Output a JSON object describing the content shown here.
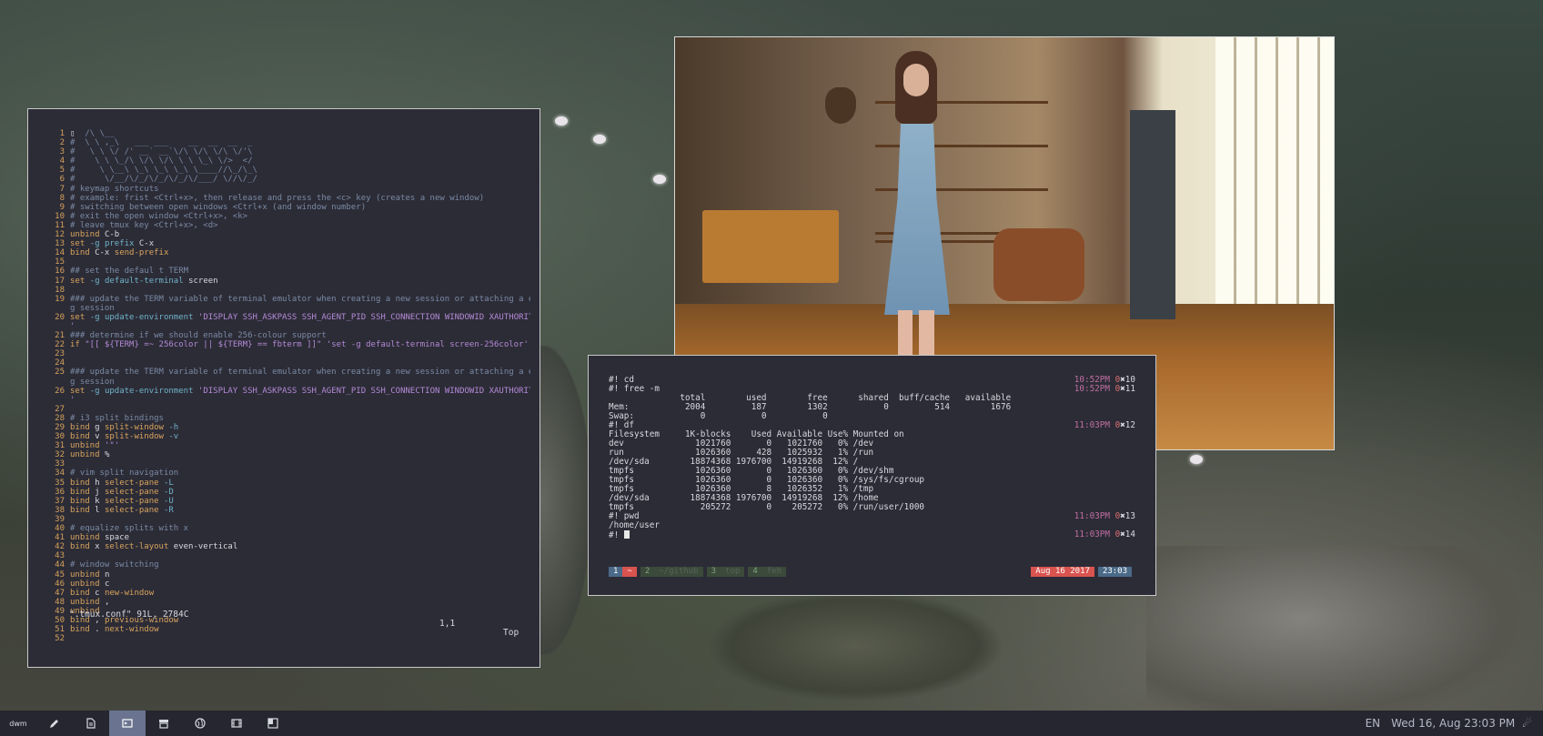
{
  "vim": {
    "lines": [
      {
        "n": "1",
        "segs": [
          [
            "c-plain",
            "▯"
          ],
          [
            "c-cmt",
            "  /\\ \\__"
          ]
        ]
      },
      {
        "n": "2",
        "segs": [
          [
            "c-cmt",
            "#  \\ \\ ,_\\   ___ ___    __  __  __  _"
          ]
        ]
      },
      {
        "n": "3",
        "segs": [
          [
            "c-cmt",
            "#   \\ \\ \\/ /' __` __`\\/\\ \\/\\ \\/\\ \\/'\\"
          ]
        ]
      },
      {
        "n": "4",
        "segs": [
          [
            "c-cmt",
            "#    \\ \\ \\_/\\ \\/\\ \\/\\ \\ \\ \\_\\ \\/>  </"
          ]
        ]
      },
      {
        "n": "5",
        "segs": [
          [
            "c-cmt",
            "#     \\ \\__\\ \\_\\ \\_\\ \\_\\ \\____//\\_/\\_\\"
          ]
        ]
      },
      {
        "n": "6",
        "segs": [
          [
            "c-cmt",
            "#      \\/__/\\/_/\\/_/\\/_/\\/___/ \\//\\/_/"
          ]
        ]
      },
      {
        "n": "7",
        "segs": [
          [
            "c-cmt",
            "# keymap shortcuts"
          ]
        ]
      },
      {
        "n": "8",
        "segs": [
          [
            "c-cmt",
            "# example: frist <Ctrl+x>, then release and press the <c> key (creates a new window)"
          ]
        ]
      },
      {
        "n": "9",
        "segs": [
          [
            "c-cmt",
            "# switching between open windows <Ctrl+x (and window number)"
          ]
        ]
      },
      {
        "n": "10",
        "segs": [
          [
            "c-cmt",
            "# exit the open window <Ctrl+x>, <k>"
          ]
        ]
      },
      {
        "n": "11",
        "segs": [
          [
            "c-cmt",
            "# leave tmux key <Ctrl+x>, <d>"
          ]
        ]
      },
      {
        "n": "12",
        "segs": [
          [
            "c-kw",
            "unbind "
          ],
          [
            "c-plain",
            "C-b"
          ]
        ]
      },
      {
        "n": "13",
        "segs": [
          [
            "c-kw",
            "set "
          ],
          [
            "c-opt",
            "-g prefix "
          ],
          [
            "c-plain",
            "C-x"
          ]
        ]
      },
      {
        "n": "14",
        "segs": [
          [
            "c-kw",
            "bind "
          ],
          [
            "c-plain",
            "C-x "
          ],
          [
            "c-kw",
            "send-prefix"
          ]
        ]
      },
      {
        "n": "15",
        "segs": []
      },
      {
        "n": "16",
        "segs": [
          [
            "c-cmt",
            "## set the defaul t TERM"
          ]
        ]
      },
      {
        "n": "17",
        "segs": [
          [
            "c-kw",
            "set "
          ],
          [
            "c-opt",
            "-g default-terminal "
          ],
          [
            "c-plain",
            "screen"
          ]
        ]
      },
      {
        "n": "18",
        "segs": []
      },
      {
        "n": "19",
        "segs": [
          [
            "c-cmt",
            "### update the TERM variable of terminal emulator when creating a new session or attaching a existin"
          ]
        ]
      },
      {
        "n": "",
        "segs": [
          [
            "c-cmt",
            "g session"
          ]
        ]
      },
      {
        "n": "20",
        "segs": [
          [
            "c-kw",
            "set "
          ],
          [
            "c-opt",
            "-g update-environment "
          ],
          [
            "c-str",
            "'DISPLAY SSH_ASKPASS SSH_AGENT_PID SSH_CONNECTION WINDOWID XAUTHORITY TERM"
          ]
        ]
      },
      {
        "n": "",
        "segs": [
          [
            "c-str",
            "'"
          ]
        ]
      },
      {
        "n": "21",
        "segs": [
          [
            "c-cmt",
            "### determine if we should enable 256-colour support"
          ]
        ]
      },
      {
        "n": "22",
        "segs": [
          [
            "c-kw",
            "if "
          ],
          [
            "c-str",
            "\"[[ ${TERM} =~ 256color || ${TERM} == fbterm ]]\" 'set -g default-terminal screen-256color'"
          ]
        ]
      },
      {
        "n": "23",
        "segs": []
      },
      {
        "n": "24",
        "segs": []
      },
      {
        "n": "25",
        "segs": [
          [
            "c-cmt",
            "### update the TERM variable of terminal emulator when creating a new session or attaching a existin"
          ]
        ]
      },
      {
        "n": "",
        "segs": [
          [
            "c-cmt",
            "g session"
          ]
        ]
      },
      {
        "n": "26",
        "segs": [
          [
            "c-kw",
            "set "
          ],
          [
            "c-opt",
            "-g update-environment "
          ],
          [
            "c-str",
            "'DISPLAY SSH_ASKPASS SSH_AGENT_PID SSH_CONNECTION WINDOWID XAUTHORITY TERM"
          ]
        ]
      },
      {
        "n": "",
        "segs": [
          [
            "c-str",
            "'"
          ]
        ]
      },
      {
        "n": "27",
        "segs": []
      },
      {
        "n": "28",
        "segs": [
          [
            "c-cmt",
            "# i3 split bindings"
          ]
        ]
      },
      {
        "n": "29",
        "segs": [
          [
            "c-kw",
            "bind "
          ],
          [
            "c-plain",
            "g "
          ],
          [
            "c-kw",
            "split-window "
          ],
          [
            "c-opt",
            "-h"
          ]
        ]
      },
      {
        "n": "30",
        "segs": [
          [
            "c-kw",
            "bind "
          ],
          [
            "c-plain",
            "v "
          ],
          [
            "c-kw",
            "split-window "
          ],
          [
            "c-opt",
            "-v"
          ]
        ]
      },
      {
        "n": "31",
        "segs": [
          [
            "c-kw",
            "unbind "
          ],
          [
            "c-str",
            "'\"'"
          ]
        ]
      },
      {
        "n": "32",
        "segs": [
          [
            "c-kw",
            "unbind "
          ],
          [
            "c-plain",
            "%"
          ]
        ]
      },
      {
        "n": "33",
        "segs": []
      },
      {
        "n": "34",
        "segs": [
          [
            "c-cmt",
            "# vim split navigation"
          ]
        ]
      },
      {
        "n": "35",
        "segs": [
          [
            "c-kw",
            "bind "
          ],
          [
            "c-plain",
            "h "
          ],
          [
            "c-kw",
            "select-pane "
          ],
          [
            "c-opt",
            "-L"
          ]
        ]
      },
      {
        "n": "36",
        "segs": [
          [
            "c-kw",
            "bind "
          ],
          [
            "c-plain",
            "j "
          ],
          [
            "c-kw",
            "select-pane "
          ],
          [
            "c-opt",
            "-D"
          ]
        ]
      },
      {
        "n": "37",
        "segs": [
          [
            "c-kw",
            "bind "
          ],
          [
            "c-plain",
            "k "
          ],
          [
            "c-kw",
            "select-pane "
          ],
          [
            "c-opt",
            "-U"
          ]
        ]
      },
      {
        "n": "38",
        "segs": [
          [
            "c-kw",
            "bind "
          ],
          [
            "c-plain",
            "l "
          ],
          [
            "c-kw",
            "select-pane "
          ],
          [
            "c-opt",
            "-R"
          ]
        ]
      },
      {
        "n": "39",
        "segs": []
      },
      {
        "n": "40",
        "segs": [
          [
            "c-cmt",
            "# equalize splits with x"
          ]
        ]
      },
      {
        "n": "41",
        "segs": [
          [
            "c-kw",
            "unbind "
          ],
          [
            "c-plain",
            "space"
          ]
        ]
      },
      {
        "n": "42",
        "segs": [
          [
            "c-kw",
            "bind "
          ],
          [
            "c-plain",
            "x "
          ],
          [
            "c-kw",
            "select-layout "
          ],
          [
            "c-plain",
            "even-vertical"
          ]
        ]
      },
      {
        "n": "43",
        "segs": []
      },
      {
        "n": "44",
        "segs": [
          [
            "c-cmt",
            "# window switching"
          ]
        ]
      },
      {
        "n": "45",
        "segs": [
          [
            "c-kw",
            "unbind "
          ],
          [
            "c-plain",
            "n"
          ]
        ]
      },
      {
        "n": "46",
        "segs": [
          [
            "c-kw",
            "unbind "
          ],
          [
            "c-plain",
            "c"
          ]
        ]
      },
      {
        "n": "47",
        "segs": [
          [
            "c-kw",
            "bind "
          ],
          [
            "c-plain",
            "c "
          ],
          [
            "c-kw",
            "new-window"
          ]
        ]
      },
      {
        "n": "48",
        "segs": [
          [
            "c-kw",
            "unbind "
          ],
          [
            "c-plain",
            ","
          ]
        ]
      },
      {
        "n": "49",
        "segs": [
          [
            "c-kw",
            "unbind "
          ],
          [
            "c-plain",
            "."
          ]
        ]
      },
      {
        "n": "50",
        "segs": [
          [
            "c-kw",
            "bind "
          ],
          [
            "c-plain",
            ", "
          ],
          [
            "c-kw",
            "previous-window"
          ]
        ]
      },
      {
        "n": "51",
        "segs": [
          [
            "c-kw",
            "bind "
          ],
          [
            "c-plain",
            ". "
          ],
          [
            "c-kw",
            "next-window"
          ]
        ]
      },
      {
        "n": "52",
        "segs": []
      }
    ],
    "status_file": "\".tmux.conf\" 91L, 2784C",
    "status_pos": "1,1",
    "status_scroll": "Top"
  },
  "terminal": {
    "rows": [
      {
        "text": "#! cd",
        "ts": "10:52PM ",
        "st": "0",
        "idx": "10"
      },
      {
        "text": "#! free -m",
        "ts": "10:52PM ",
        "st": "0",
        "idx": "11"
      },
      {
        "text": "              total        used        free      shared  buff/cache   available"
      },
      {
        "text": "Mem:           2004         187        1302           0         514        1676"
      },
      {
        "text": "Swap:             0           0           0"
      },
      {
        "text": "#! df",
        "ts": "11:03PM ",
        "st": "0",
        "idx": "12"
      },
      {
        "text": "Filesystem     1K-blocks    Used Available Use% Mounted on"
      },
      {
        "text": "dev              1021760       0   1021760   0% /dev"
      },
      {
        "text": "run              1026360     428   1025932   1% /run"
      },
      {
        "text": "/dev/sda        18874368 1976700  14919268  12% /"
      },
      {
        "text": "tmpfs            1026360       0   1026360   0% /dev/shm"
      },
      {
        "text": "tmpfs            1026360       0   1026360   0% /sys/fs/cgroup"
      },
      {
        "text": "tmpfs            1026360       8   1026352   1% /tmp"
      },
      {
        "text": "/dev/sda        18874368 1976700  14919268  12% /home"
      },
      {
        "text": "tmpfs             205272       0    205272   0% /run/user/1000"
      },
      {
        "text": "#! pwd",
        "ts": "11:03PM ",
        "st": "0",
        "idx": "13"
      },
      {
        "text": "/home/user"
      },
      {
        "text": "#! ",
        "ts": "11:03PM ",
        "st": "0",
        "idx": "14",
        "cursor": true
      }
    ],
    "tmux": {
      "windows": [
        {
          "num": "1",
          "name": "~",
          "active": true
        },
        {
          "num": "2",
          "name": "~/github"
        },
        {
          "num": "3",
          "name": "top"
        },
        {
          "num": "4",
          "name": "feh"
        }
      ],
      "date": "Aug 16 2017",
      "time": "23:03"
    }
  },
  "taskbar": {
    "logo": "dwm",
    "icons": [
      "pencil-icon",
      "document-icon",
      "terminal-icon",
      "archive-icon",
      "globe-icon",
      "film-icon",
      "layout-icon"
    ],
    "active_index": 2,
    "lang": "EN",
    "datetime": "Wed 16, Aug 23:03 PM",
    "status_symbol": "☄"
  },
  "colors": {
    "terminal_bg": "#2c2c37",
    "accent_red": "#d9534f",
    "accent_blue": "#4a6a88",
    "taskbar_bg": "#262630"
  }
}
